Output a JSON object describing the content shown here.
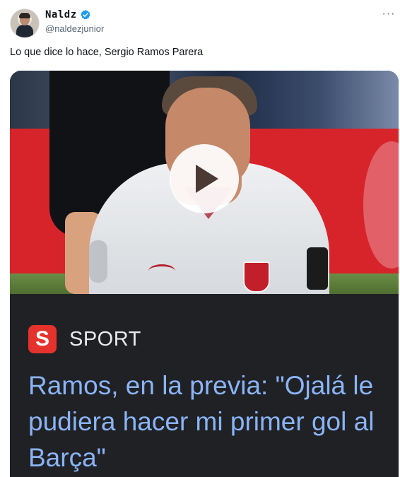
{
  "author": {
    "display_name": "Naldz",
    "handle": "@naldezjunior",
    "verified": true
  },
  "tweet": {
    "text": "Lo que dice lo hace, Sergio Ramos Parera"
  },
  "menu": {
    "icon": "more-horizontal-icon",
    "label": "···"
  },
  "media": {
    "type": "video",
    "play_icon": "play-icon"
  },
  "link_card": {
    "source_logo_letter": "S",
    "source_name": "SPORT",
    "headline": "Ramos, en la previa: \"Ojalá le pudiera hacer mi primer gol al Barça\"",
    "colors": {
      "background": "#202124",
      "headline": "#8ab4f8",
      "logo": "#e5322d"
    }
  },
  "colors": {
    "verified_badge": "#1d9bf0",
    "secondary_text": "#536471"
  }
}
